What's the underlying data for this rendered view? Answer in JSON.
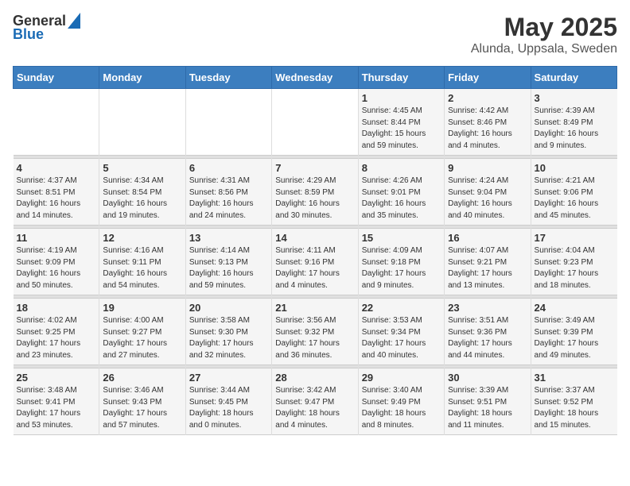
{
  "header": {
    "logo_general": "General",
    "logo_blue": "Blue",
    "title": "May 2025",
    "subtitle": "Alunda, Uppsala, Sweden"
  },
  "days_of_week": [
    "Sunday",
    "Monday",
    "Tuesday",
    "Wednesday",
    "Thursday",
    "Friday",
    "Saturday"
  ],
  "weeks": [
    [
      {
        "num": "",
        "info": ""
      },
      {
        "num": "",
        "info": ""
      },
      {
        "num": "",
        "info": ""
      },
      {
        "num": "",
        "info": ""
      },
      {
        "num": "1",
        "info": "Sunrise: 4:45 AM\nSunset: 8:44 PM\nDaylight: 15 hours\nand 59 minutes."
      },
      {
        "num": "2",
        "info": "Sunrise: 4:42 AM\nSunset: 8:46 PM\nDaylight: 16 hours\nand 4 minutes."
      },
      {
        "num": "3",
        "info": "Sunrise: 4:39 AM\nSunset: 8:49 PM\nDaylight: 16 hours\nand 9 minutes."
      }
    ],
    [
      {
        "num": "4",
        "info": "Sunrise: 4:37 AM\nSunset: 8:51 PM\nDaylight: 16 hours\nand 14 minutes."
      },
      {
        "num": "5",
        "info": "Sunrise: 4:34 AM\nSunset: 8:54 PM\nDaylight: 16 hours\nand 19 minutes."
      },
      {
        "num": "6",
        "info": "Sunrise: 4:31 AM\nSunset: 8:56 PM\nDaylight: 16 hours\nand 24 minutes."
      },
      {
        "num": "7",
        "info": "Sunrise: 4:29 AM\nSunset: 8:59 PM\nDaylight: 16 hours\nand 30 minutes."
      },
      {
        "num": "8",
        "info": "Sunrise: 4:26 AM\nSunset: 9:01 PM\nDaylight: 16 hours\nand 35 minutes."
      },
      {
        "num": "9",
        "info": "Sunrise: 4:24 AM\nSunset: 9:04 PM\nDaylight: 16 hours\nand 40 minutes."
      },
      {
        "num": "10",
        "info": "Sunrise: 4:21 AM\nSunset: 9:06 PM\nDaylight: 16 hours\nand 45 minutes."
      }
    ],
    [
      {
        "num": "11",
        "info": "Sunrise: 4:19 AM\nSunset: 9:09 PM\nDaylight: 16 hours\nand 50 minutes."
      },
      {
        "num": "12",
        "info": "Sunrise: 4:16 AM\nSunset: 9:11 PM\nDaylight: 16 hours\nand 54 minutes."
      },
      {
        "num": "13",
        "info": "Sunrise: 4:14 AM\nSunset: 9:13 PM\nDaylight: 16 hours\nand 59 minutes."
      },
      {
        "num": "14",
        "info": "Sunrise: 4:11 AM\nSunset: 9:16 PM\nDaylight: 17 hours\nand 4 minutes."
      },
      {
        "num": "15",
        "info": "Sunrise: 4:09 AM\nSunset: 9:18 PM\nDaylight: 17 hours\nand 9 minutes."
      },
      {
        "num": "16",
        "info": "Sunrise: 4:07 AM\nSunset: 9:21 PM\nDaylight: 17 hours\nand 13 minutes."
      },
      {
        "num": "17",
        "info": "Sunrise: 4:04 AM\nSunset: 9:23 PM\nDaylight: 17 hours\nand 18 minutes."
      }
    ],
    [
      {
        "num": "18",
        "info": "Sunrise: 4:02 AM\nSunset: 9:25 PM\nDaylight: 17 hours\nand 23 minutes."
      },
      {
        "num": "19",
        "info": "Sunrise: 4:00 AM\nSunset: 9:27 PM\nDaylight: 17 hours\nand 27 minutes."
      },
      {
        "num": "20",
        "info": "Sunrise: 3:58 AM\nSunset: 9:30 PM\nDaylight: 17 hours\nand 32 minutes."
      },
      {
        "num": "21",
        "info": "Sunrise: 3:56 AM\nSunset: 9:32 PM\nDaylight: 17 hours\nand 36 minutes."
      },
      {
        "num": "22",
        "info": "Sunrise: 3:53 AM\nSunset: 9:34 PM\nDaylight: 17 hours\nand 40 minutes."
      },
      {
        "num": "23",
        "info": "Sunrise: 3:51 AM\nSunset: 9:36 PM\nDaylight: 17 hours\nand 44 minutes."
      },
      {
        "num": "24",
        "info": "Sunrise: 3:49 AM\nSunset: 9:39 PM\nDaylight: 17 hours\nand 49 minutes."
      }
    ],
    [
      {
        "num": "25",
        "info": "Sunrise: 3:48 AM\nSunset: 9:41 PM\nDaylight: 17 hours\nand 53 minutes."
      },
      {
        "num": "26",
        "info": "Sunrise: 3:46 AM\nSunset: 9:43 PM\nDaylight: 17 hours\nand 57 minutes."
      },
      {
        "num": "27",
        "info": "Sunrise: 3:44 AM\nSunset: 9:45 PM\nDaylight: 18 hours\nand 0 minutes."
      },
      {
        "num": "28",
        "info": "Sunrise: 3:42 AM\nSunset: 9:47 PM\nDaylight: 18 hours\nand 4 minutes."
      },
      {
        "num": "29",
        "info": "Sunrise: 3:40 AM\nSunset: 9:49 PM\nDaylight: 18 hours\nand 8 minutes."
      },
      {
        "num": "30",
        "info": "Sunrise: 3:39 AM\nSunset: 9:51 PM\nDaylight: 18 hours\nand 11 minutes."
      },
      {
        "num": "31",
        "info": "Sunrise: 3:37 AM\nSunset: 9:52 PM\nDaylight: 18 hours\nand 15 minutes."
      }
    ]
  ]
}
